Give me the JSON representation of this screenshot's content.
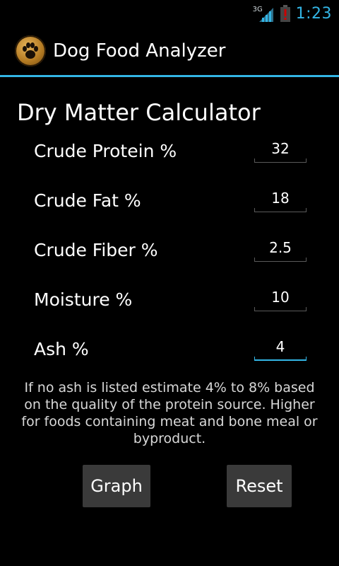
{
  "status_bar": {
    "network_type": "3G",
    "time": "1:23",
    "signal_icon": "cell-signal-icon",
    "battery_icon": "battery-alert-icon",
    "accent_color": "#33b5e5",
    "battery_alert_color": "#cc0000"
  },
  "action_bar": {
    "icon": "paw-icon",
    "title": "Dog Food Analyzer"
  },
  "calculator": {
    "heading": "Dry Matter Calculator",
    "fields": [
      {
        "label": "Crude Protein %",
        "value": "32"
      },
      {
        "label": "Crude Fat %",
        "value": "18"
      },
      {
        "label": "Crude Fiber %",
        "value": "2.5"
      },
      {
        "label": "Moisture %",
        "value": "10"
      },
      {
        "label": "Ash %",
        "value": "4"
      }
    ],
    "hint": "If no ash is listed estimate 4% to 8% based on the quality of the protein source. Higher for foods containing meat and bone meal or byproduct."
  },
  "buttons": {
    "graph_label": "Graph",
    "reset_label": "Reset"
  }
}
